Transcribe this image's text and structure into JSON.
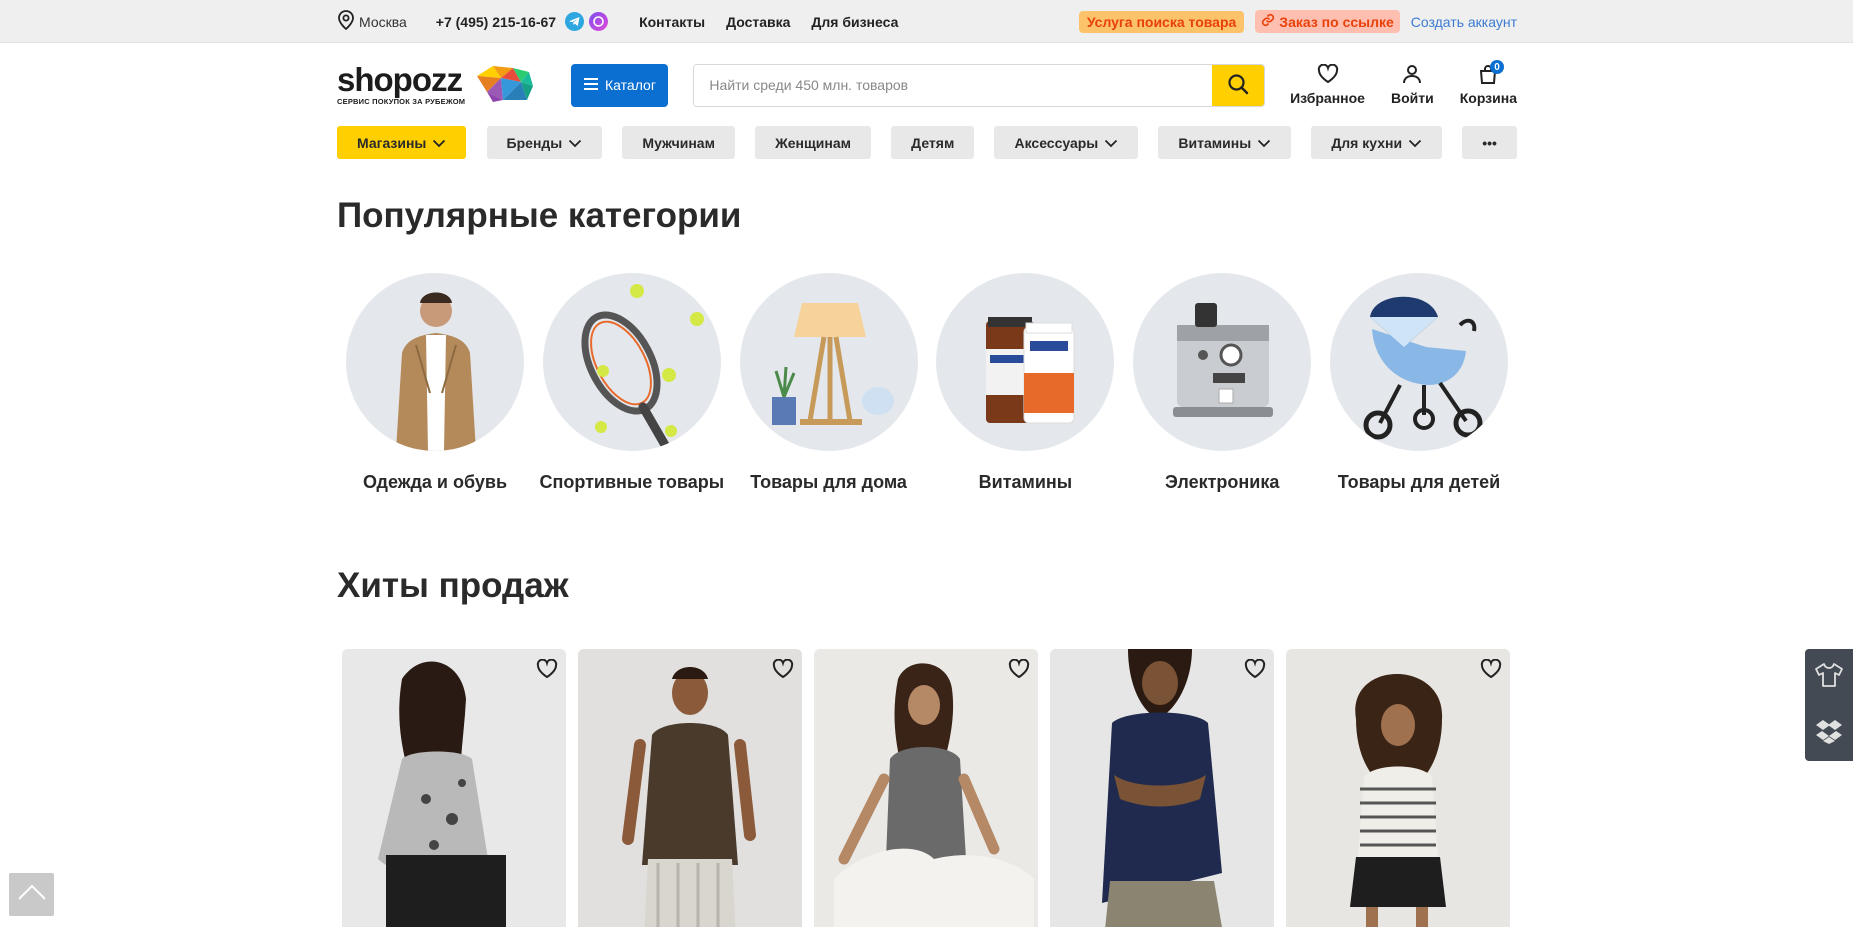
{
  "topbar": {
    "city": "Москва",
    "phone": "+7 (495) 215-16-67",
    "links": [
      "Контакты",
      "Доставка",
      "Для бизнеса"
    ],
    "search_service": "Услуга поиска товара",
    "order_by_link": "Заказ по ссылке",
    "create_account": "Создать аккаунт"
  },
  "header": {
    "logo_word": "shopozz",
    "logo_sub": "СЕРВИС ПОКУПОК ЗА РУБЕЖОМ",
    "catalog_label": "Каталог",
    "search_placeholder": "Найти среди 450 млн. товаров",
    "favorites_label": "Избранное",
    "login_label": "Войти",
    "cart_label": "Корзина",
    "cart_count": "0"
  },
  "nav": {
    "items": [
      {
        "label": "Магазины",
        "dropdown": true,
        "active": true
      },
      {
        "label": "Бренды",
        "dropdown": true
      },
      {
        "label": "Мужчинам",
        "dropdown": false
      },
      {
        "label": "Женщинам",
        "dropdown": false
      },
      {
        "label": "Детям",
        "dropdown": false
      },
      {
        "label": "Аксессуары",
        "dropdown": true
      },
      {
        "label": "Витамины",
        "dropdown": true
      },
      {
        "label": "Для кухни",
        "dropdown": true
      }
    ],
    "more_label": "•••"
  },
  "popular": {
    "title": "Популярные категории",
    "categories": [
      {
        "label": "Одежда и обувь",
        "icon": "jacket-image"
      },
      {
        "label": "Спортивные товары",
        "icon": "tennis-racket-image"
      },
      {
        "label": "Товары для дома",
        "icon": "lamp-image"
      },
      {
        "label": "Витамины",
        "icon": "vitamins-image"
      },
      {
        "label": "Электроника",
        "icon": "coffee-machine-image"
      },
      {
        "label": "Товары для детей",
        "icon": "stroller-image"
      }
    ]
  },
  "hits": {
    "title": "Хиты продаж",
    "products": [
      {
        "name": "product-photo-1"
      },
      {
        "name": "product-photo-2"
      },
      {
        "name": "product-photo-3"
      },
      {
        "name": "product-photo-4"
      },
      {
        "name": "product-photo-5"
      }
    ]
  },
  "colors": {
    "accent_yellow": "#ffcf00",
    "primary_blue": "#0a6fd0",
    "orange": "#e8410a"
  }
}
